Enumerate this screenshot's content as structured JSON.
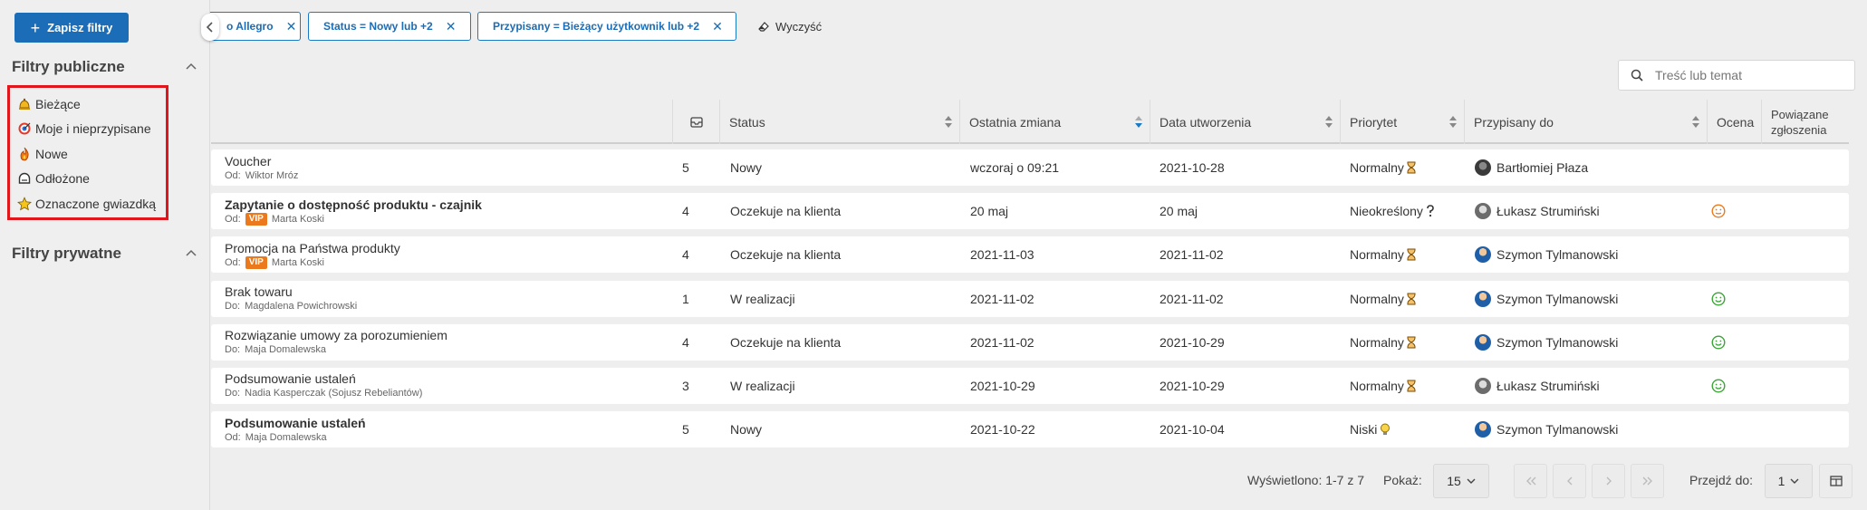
{
  "sidebar": {
    "save_button": "Zapisz filtry",
    "public_title": "Filtry publiczne",
    "private_title": "Filtry prywatne",
    "public_filters": [
      {
        "label": "Bieżące",
        "icon": "bell-icon"
      },
      {
        "label": "Moje i nieprzypisane",
        "icon": "target-icon"
      },
      {
        "label": "Nowe",
        "icon": "fire-icon"
      },
      {
        "label": "Odłożone",
        "icon": "snooze-icon"
      },
      {
        "label": "Oznaczone gwiazdką",
        "icon": "star-icon"
      }
    ]
  },
  "chips": [
    {
      "label": "o Allegro"
    },
    {
      "label": "Status = Nowy lub +2"
    },
    {
      "label": "Przypisany = Bieżący użytkownik lub +2"
    }
  ],
  "clear_label": "Wyczyść",
  "search": {
    "placeholder": "Treść lub temat"
  },
  "table": {
    "columns": {
      "status": "Status",
      "last_change": "Ostatnia zmiana",
      "created": "Data utworzenia",
      "priority": "Priorytet",
      "assigned": "Przypisany do",
      "rating": "Ocena",
      "related_1": "Powiązane",
      "related_2": "zgłoszenia"
    },
    "rows": [
      {
        "subject": "Voucher",
        "bold": false,
        "from_label": "Od:",
        "from": "Wiktor Mróz",
        "vip": false,
        "count": "5",
        "status": "Nowy",
        "last_change": "wczoraj o 09:21",
        "created": "2021-10-28",
        "priority": "Normalny",
        "priority_icon": "hourglass-icon",
        "assigned": "Bartłomiej Płaza",
        "avatar": "dark",
        "rating": ""
      },
      {
        "subject": "Zapytanie o dostępność produktu - czajnik",
        "bold": true,
        "from_label": "Od:",
        "from": "Marta Koski",
        "vip": true,
        "count": "4",
        "status": "Oczekuje na klienta",
        "last_change": "20 maj",
        "created": "20 maj",
        "priority": "Nieokreślony",
        "priority_icon": "question-icon",
        "assigned": "Łukasz Strumiński",
        "avatar": "gray",
        "rating": "neutral"
      },
      {
        "subject": "Promocja na Państwa produkty",
        "bold": false,
        "from_label": "Od:",
        "from": "Marta Koski",
        "vip": true,
        "count": "4",
        "status": "Oczekuje na klienta",
        "last_change": "2021-11-03",
        "created": "2021-11-02",
        "priority": "Normalny",
        "priority_icon": "hourglass-icon",
        "assigned": "Szymon Tylmanowski",
        "avatar": "blue",
        "rating": ""
      },
      {
        "subject": "Brak towaru",
        "bold": false,
        "from_label": "Do:",
        "from": "Magdalena Powichrowski",
        "vip": false,
        "count": "1",
        "status": "W realizacji",
        "last_change": "2021-11-02",
        "created": "2021-11-02",
        "priority": "Normalny",
        "priority_icon": "hourglass-icon",
        "assigned": "Szymon Tylmanowski",
        "avatar": "blue",
        "rating": "happy"
      },
      {
        "subject": "Rozwiązanie umowy za porozumieniem",
        "bold": false,
        "from_label": "Do:",
        "from": "Maja Domalewska",
        "vip": false,
        "count": "4",
        "status": "Oczekuje na klienta",
        "last_change": "2021-11-02",
        "created": "2021-10-29",
        "priority": "Normalny",
        "priority_icon": "hourglass-icon",
        "assigned": "Szymon Tylmanowski",
        "avatar": "blue",
        "rating": "happy"
      },
      {
        "subject": "Podsumowanie ustaleń",
        "bold": false,
        "from_label": "Do:",
        "from": "Nadia Kasperczak (Sojusz Rebeliantów)",
        "vip": false,
        "count": "3",
        "status": "W realizacji",
        "last_change": "2021-10-29",
        "created": "2021-10-29",
        "priority": "Normalny",
        "priority_icon": "hourglass-icon",
        "assigned": "Łukasz Strumiński",
        "avatar": "gray",
        "rating": "happy"
      },
      {
        "subject": "Podsumowanie ustaleń",
        "bold": true,
        "from_label": "Od:",
        "from": "Maja Domalewska",
        "vip": false,
        "count": "5",
        "status": "Nowy",
        "last_change": "2021-10-22",
        "created": "2021-10-04",
        "priority": "Niski",
        "priority_icon": "bulb-icon",
        "assigned": "Szymon Tylmanowski",
        "avatar": "blue",
        "rating": ""
      }
    ]
  },
  "vip_label": "VIP",
  "footer": {
    "shown": "Wyświetlono: 1-7 z 7",
    "show_label": "Pokaż:",
    "page_size": "15",
    "goto_label": "Przejdź do:",
    "goto_value": "1"
  },
  "colors": {
    "accent": "#1a6db6",
    "vip": "#ec7a1d",
    "highlight": "#e0161c",
    "happy": "#3aa635",
    "neutral": "#ec7a1d"
  }
}
